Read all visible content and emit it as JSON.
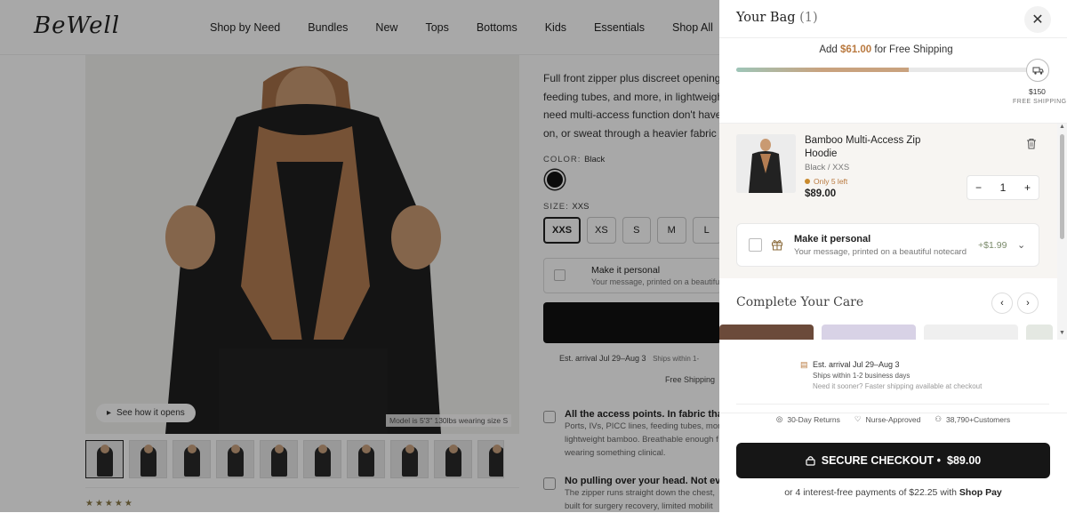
{
  "header": {
    "logo": "BeWell",
    "nav": [
      "Shop by Need",
      "Bundles",
      "New",
      "Tops",
      "Bottoms",
      "Kids",
      "Essentials",
      "Shop All"
    ]
  },
  "gallery": {
    "see_how_label": "See how it opens",
    "model_note": "Model is 5'3\" 130lbs wearing size S"
  },
  "product": {
    "description_lines": [
      "Full front zipper plus discreet openings",
      "feeding tubes, and more, in lightweigh",
      "need multi-access function don't have",
      "on, or sweat through a heavier fabric ju"
    ],
    "color_label": "COLOR:",
    "color_value": "Black",
    "size_label": "SIZE:",
    "size_value": "XXS",
    "sizes": [
      "XXS",
      "XS",
      "S",
      "M",
      "L"
    ],
    "personal_title": "Make it personal",
    "personal_sub": "Your message, printed on a beautiful",
    "est_arrival": "Est. arrival Jul 29–Aug 3",
    "ships": "Ships within 1-",
    "free_shipping": "Free Shipping",
    "features": [
      {
        "title": "All the access points. In fabric that c",
        "lines": [
          "Ports, IVs, PICC lines, feeding tubes, mor",
          "lightweight bamboo. Breathable enough f",
          "wearing something clinical."
        ]
      },
      {
        "title": "No pulling over your head. Not even",
        "lines": [
          "The zipper runs straight down the chest,",
          "built for surgery recovery, limited mobilit"
        ]
      }
    ],
    "stars": "★★★★★"
  },
  "cart": {
    "title": "Your Bag",
    "count": "(1)",
    "shipping_prefix": "Add ",
    "shipping_amount": "$61.00",
    "shipping_suffix": " for Free Shipping",
    "progress_fraction": 0.59,
    "threshold": "$150",
    "threshold_label": "FREE SHIPPING",
    "item": {
      "name": "Bamboo Multi-Access Zip Hoodie",
      "variant": "Black / XXS",
      "stock": "Only 5 left",
      "price": "$89.00",
      "qty": "1"
    },
    "personal": {
      "title": "Make it personal",
      "sub": "Your message, printed on a beautiful notecard",
      "price": "+$1.99"
    },
    "complete_title": "Complete Your Care",
    "est_arrival": "Est. arrival Jul 29–Aug 3",
    "ships_within": "Ships within 1-2 business days",
    "need_sooner": "Need it sooner? Faster shipping available at checkout",
    "badges": [
      "30-Day Returns",
      "Nurse-Approved",
      "38,790+Customers"
    ],
    "checkout_label": "SECURE CHECKOUT •",
    "checkout_price": "$89.00",
    "installments_prefix": "or 4 interest-free payments of $22.25 with ",
    "installments_brand": "Shop Pay"
  },
  "colors": {
    "accent": "#b9793f",
    "checkout": "#161616",
    "progress_start": "#9ec5b8",
    "progress_end": "#c9a27e"
  }
}
